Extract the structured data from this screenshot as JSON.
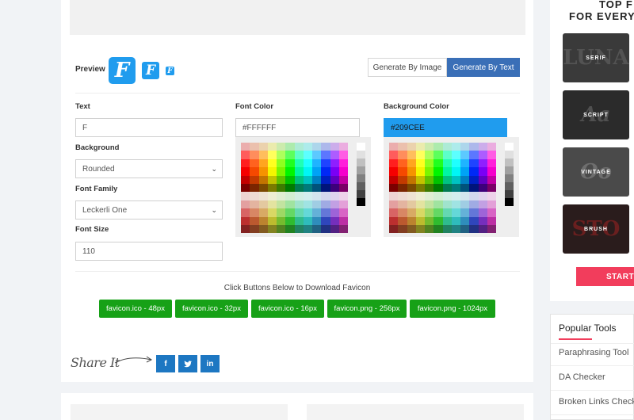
{
  "preview": {
    "label": "Preview",
    "letter": "F"
  },
  "tabs": {
    "by_image": "Generate By Image",
    "by_text": "Generate By Text"
  },
  "form": {
    "text_label": "Text",
    "text_value": "F",
    "background_label": "Background",
    "background_value": "Rounded",
    "font_family_label": "Font Family",
    "font_family_value": "Leckerli One",
    "font_size_label": "Font Size",
    "font_size_value": "110",
    "font_color_label": "Font Color",
    "font_color_value": "#FFFFFF",
    "bg_color_label": "Background Color",
    "bg_color_value": "#209CEE"
  },
  "download": {
    "caption": "Click Buttons Below to Download Favicon",
    "buttons": [
      "favicon.ico - 48px",
      "favicon.ico - 32px",
      "favicon.ico - 16px",
      "favicon.png - 256px",
      "favicon.png - 1024px"
    ]
  },
  "share": {
    "label": "Share It",
    "networks": [
      "f",
      "t",
      "in"
    ]
  },
  "sidebar": {
    "heading_line1": "TOP F",
    "heading_line2": "FOR EVERY",
    "fonts": [
      "SERIF",
      "SCRIPT",
      "VINTAGE",
      "BRUSH"
    ],
    "start_label": "START"
  },
  "popular_tools": {
    "title": "Popular Tools",
    "items": [
      "Paraphrasing Tool",
      "DA Checker",
      "Broken Links Checker"
    ]
  },
  "colors": {
    "accent": "#209cee",
    "tab_active": "#3a6fb7",
    "download_green": "#17a117",
    "start_red": "#f23d5c"
  }
}
